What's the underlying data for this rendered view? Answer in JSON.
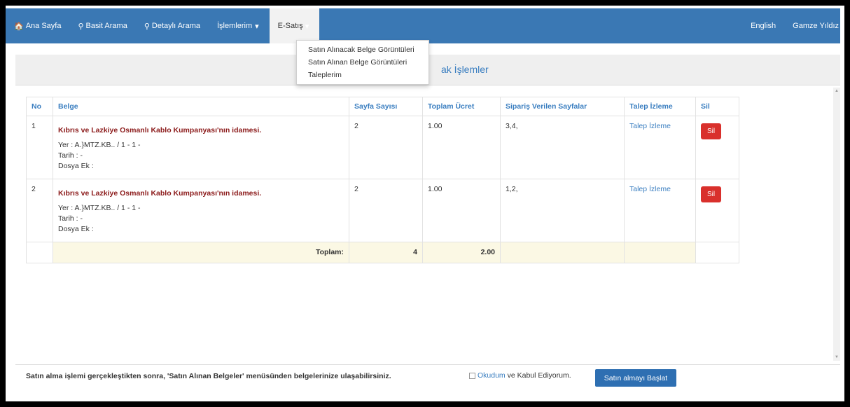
{
  "nav": {
    "home": "Ana Sayfa",
    "simple_search": "Basit Arama",
    "detailed_search": "Detaylı Arama",
    "my_operations": "İşlemlerim",
    "esatis": "E-Satış",
    "english": "English",
    "user": "Gamze Yıldız"
  },
  "dropdown": {
    "items": [
      "Satın Alınacak Belge Görüntüleri",
      "Satın Alınan Belge Görüntüleri",
      "Taleplerim"
    ]
  },
  "band_title": "ak İşlemler",
  "table": {
    "headers": [
      "No",
      "Belge",
      "Sayfa Sayısı",
      "Toplam Ücret",
      "Sipariş Verilen Sayfalar",
      "Talep İzleme",
      "Sil"
    ],
    "rows": [
      {
        "no": "1",
        "title": "Kıbrıs ve Lazkiye Osmanlı Kablo Kumpanyası'nın idamesi.",
        "yer": "Yer : A.}MTZ.KB.. / 1 - 1 -",
        "tarih": "Tarih : -",
        "dosya": "Dosya Ek :",
        "pages": "2",
        "fee": "1.00",
        "ordered": "3,4,",
        "track": "Talep İzleme",
        "delete": "Sil"
      },
      {
        "no": "2",
        "title": "Kıbrıs ve Lazkiye Osmanlı Kablo Kumpanyası'nın idamesi.",
        "yer": "Yer : A.}MTZ.KB.. / 1 - 1 -",
        "tarih": "Tarih : -",
        "dosya": "Dosya Ek :",
        "pages": "2",
        "fee": "1.00",
        "ordered": "1,2,",
        "track": "Talep İzleme",
        "delete": "Sil"
      }
    ],
    "total_label": "Toplam:",
    "total_pages": "4",
    "total_fee": "2.00"
  },
  "footer": {
    "note": "Satın alma işlemi gerçekleştikten sonra, 'Satın Alınan Belgeler' menüsünden belgelerinize ulaşabilirsiniz.",
    "agree_link": "Okudum",
    "agree_text": " ve Kabul Ediyorum.",
    "start_button": "Satın almayı Başlat"
  }
}
